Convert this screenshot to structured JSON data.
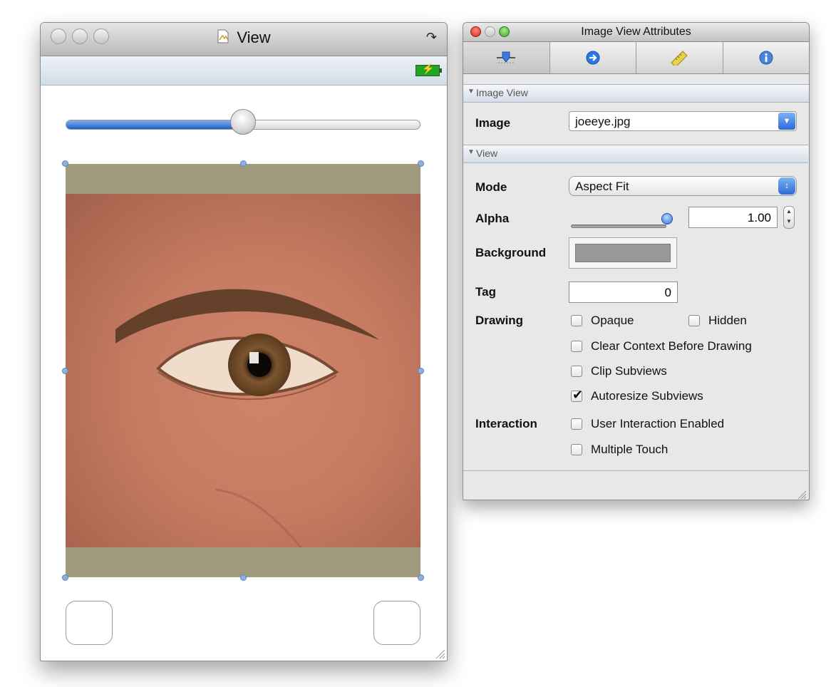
{
  "view_window": {
    "title": "View",
    "title_icon": "document-icon",
    "zoom_icon": "zoom-arrow-icon",
    "slider": {
      "value": 0.5
    },
    "image_view": {
      "content": "photo of an eye"
    }
  },
  "inspector": {
    "title": "Image View Attributes",
    "tabs": [
      {
        "name": "attributes",
        "icon": "slider-attributes-icon"
      },
      {
        "name": "connections",
        "icon": "arrow-circle-icon"
      },
      {
        "name": "size",
        "icon": "ruler-icon"
      },
      {
        "name": "identity",
        "icon": "info-icon"
      }
    ],
    "sections": {
      "image_view": "Image View",
      "view": "View"
    },
    "image": {
      "label": "Image",
      "value": "joeeye.jpg"
    },
    "mode": {
      "label": "Mode",
      "value": "Aspect Fit"
    },
    "alpha": {
      "label": "Alpha",
      "value": "1.00",
      "slider": 1.0
    },
    "background": {
      "label": "Background",
      "color": "#999999"
    },
    "tag": {
      "label": "Tag",
      "value": "0"
    },
    "drawing": {
      "label": "Drawing",
      "opaque": "Opaque",
      "hidden": "Hidden",
      "clear_context": "Clear Context Before Drawing",
      "clip_subviews": "Clip Subviews",
      "autoresize": "Autoresize Subviews"
    },
    "interaction": {
      "label": "Interaction",
      "user_interaction": "User Interaction Enabled",
      "multiple_touch": "Multiple Touch"
    }
  }
}
